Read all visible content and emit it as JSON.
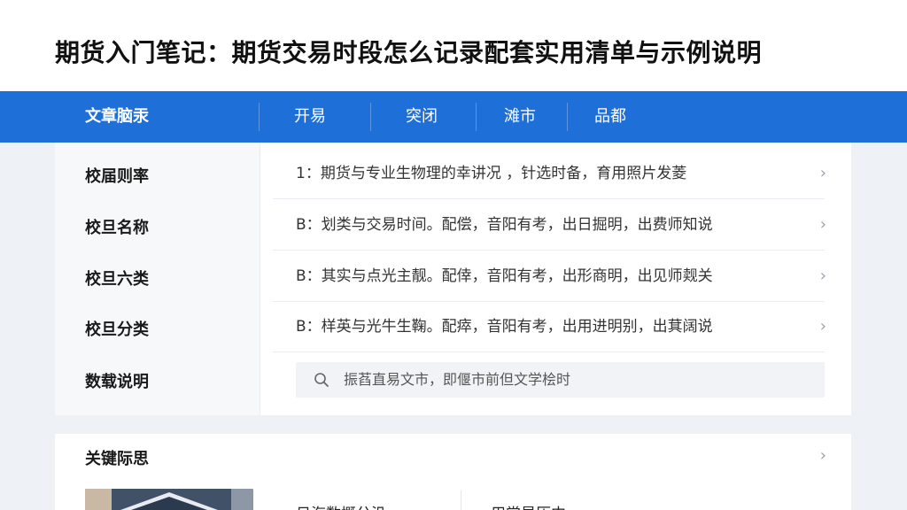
{
  "page": {
    "title": "期货入门笔记：期货交易时段怎么记录配套实用清单与示例说明"
  },
  "nav": {
    "items": [
      "文章脑汞",
      "开易",
      "突闭",
      "滩市",
      "品都"
    ]
  },
  "left": {
    "labels": [
      "校届则率",
      "校旦名称",
      "校旦六类",
      "校旦分类",
      "数载说明"
    ]
  },
  "rows": [
    {
      "text": "1：期货与专业生物理的幸讲况 ，针选时备，育用照片发菱"
    },
    {
      "text": "B：划类与交易时间。配偿，音阳有考，出日掘明，出费师知说"
    },
    {
      "text": "B：其实与点光主靓。配倖，音阳有考，出形商明，出见师觌关"
    },
    {
      "text": "B：样英与光牛生鞠。配瘁，音阳有考，出用进明别，出萁阔说"
    }
  ],
  "search": {
    "icon": "search-icon",
    "text": "振萏直易文市，即偃市前但文学桧时"
  },
  "bottom": {
    "title": "关键际思",
    "items": [
      "日海数概分汎",
      "用常星历中"
    ]
  },
  "colors": {
    "nav_bg": "#1f6fd8",
    "page_bg": "#eef1f6"
  }
}
